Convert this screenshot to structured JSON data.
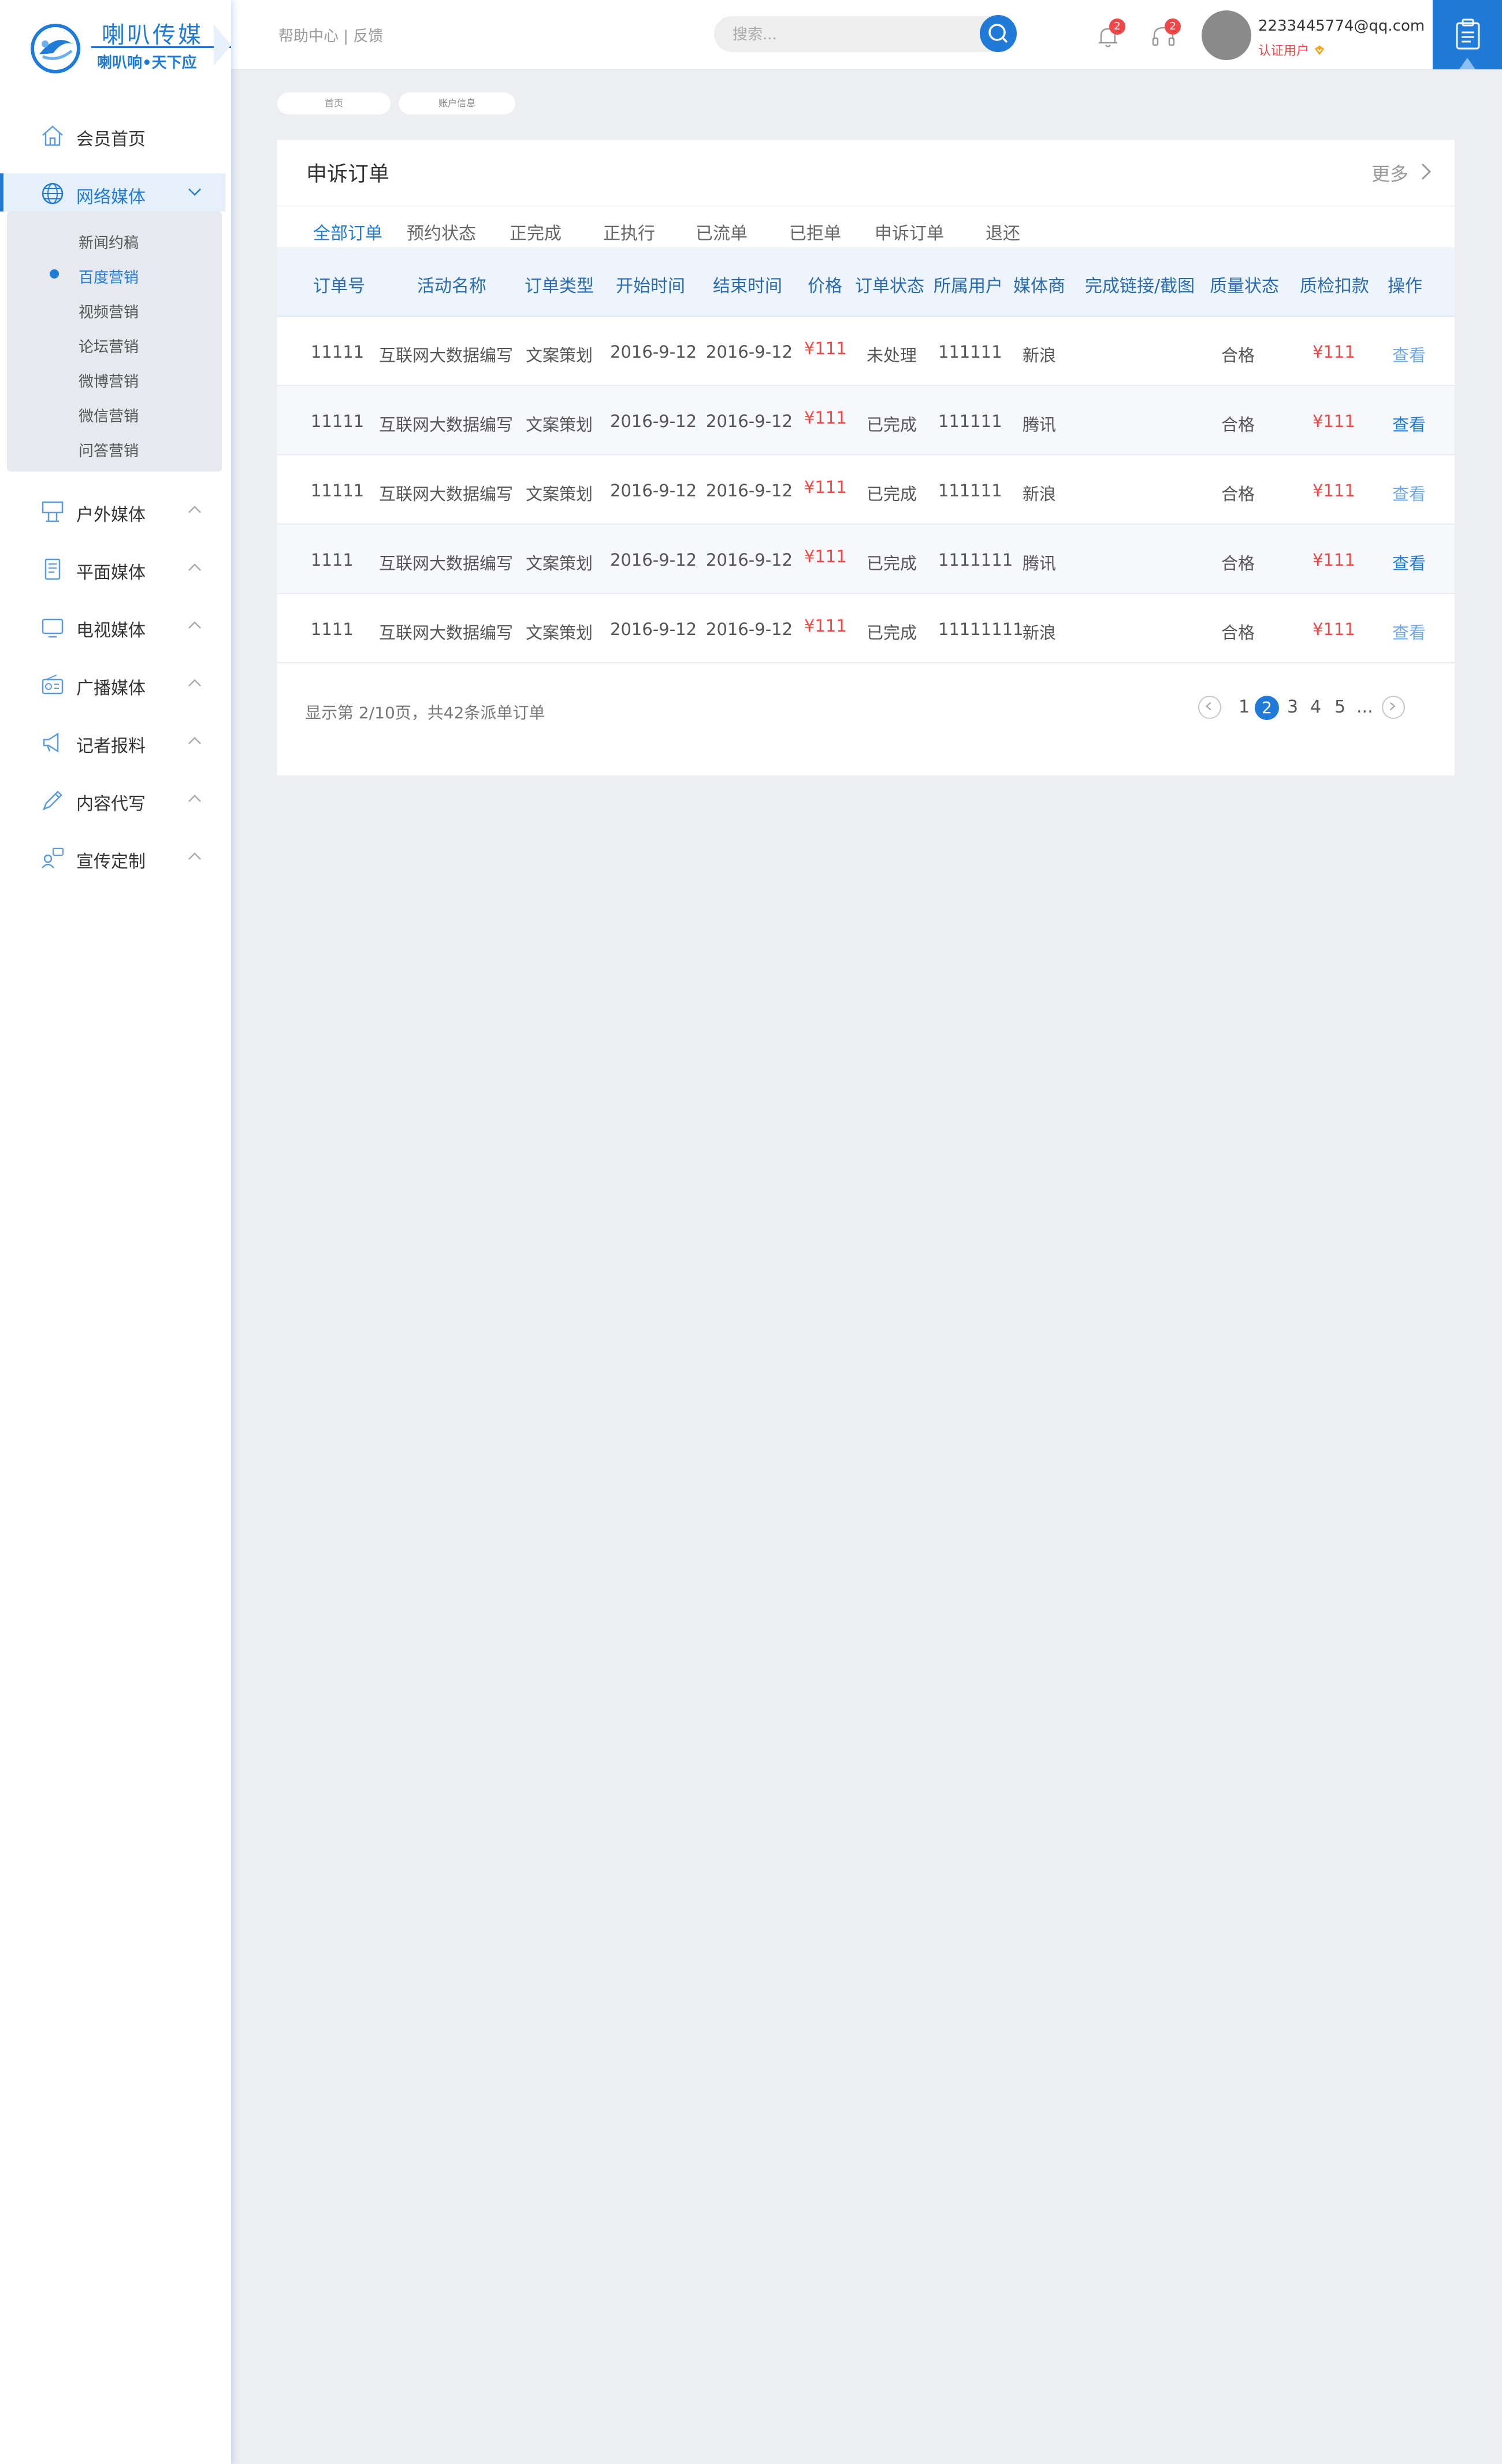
{
  "brand": {
    "title": "喇叭传媒",
    "slogan": "喇叭响•天下应"
  },
  "header": {
    "help": "帮助中心",
    "feedback": "反馈",
    "search_placeholder": "搜索...",
    "notifications_count": "2",
    "service_count": "2",
    "email": "2233445774@qq.com",
    "verified": "认证用户"
  },
  "sidebar": {
    "items": [
      {
        "label": "会员首页",
        "icon": "home-icon"
      },
      {
        "label": "网络媒体",
        "icon": "globe-icon"
      },
      {
        "label": "户外媒体",
        "icon": "billboard-icon"
      },
      {
        "label": "平面媒体",
        "icon": "print-icon"
      },
      {
        "label": "电视媒体",
        "icon": "tv-icon"
      },
      {
        "label": "广播媒体",
        "icon": "radio-icon"
      },
      {
        "label": "记者报料",
        "icon": "megaphone-icon"
      },
      {
        "label": "内容代写",
        "icon": "pen-icon"
      },
      {
        "label": "宣传定制",
        "icon": "custom-icon"
      }
    ],
    "subitems": [
      "新闻约稿",
      "百度营销",
      "视频营销",
      "论坛营销",
      "微博营销",
      "微信营销",
      "问答营销"
    ]
  },
  "breadcrumb": [
    "首页",
    "账户信息"
  ],
  "panel": {
    "title": "申诉订单",
    "more": "更多",
    "tabs": [
      "全部订单",
      "预约状态",
      "正完成",
      "正执行",
      "已流单",
      "已拒单",
      "申诉订单",
      "退还"
    ],
    "columns": [
      "订单号",
      "活动名称",
      "订单类型",
      "开始时间",
      "结束时间",
      "价格",
      "订单状态",
      "所属用户",
      "媒体商",
      "完成链接/截图",
      "质量状态",
      "质检扣款",
      "操作"
    ],
    "rows": [
      {
        "id": "11111",
        "name": "互联网大数据编写",
        "type": "文案策划",
        "start": "2016-9-12",
        "end": "2016-9-12",
        "price": "¥111",
        "status": "未处理",
        "user": "111111",
        "vendor": "新浪",
        "quality": "合格",
        "deduct": "¥111",
        "action": "查看"
      },
      {
        "id": "11111",
        "name": "互联网大数据编写",
        "type": "文案策划",
        "start": "2016-9-12",
        "end": "2016-9-12",
        "price": "¥111",
        "status": "已完成",
        "user": "111111",
        "vendor": "腾讯",
        "quality": "合格",
        "deduct": "¥111",
        "action": "查看"
      },
      {
        "id": "11111",
        "name": "互联网大数据编写",
        "type": "文案策划",
        "start": "2016-9-12",
        "end": "2016-9-12",
        "price": "¥111",
        "status": "已完成",
        "user": "111111",
        "vendor": "新浪",
        "quality": "合格",
        "deduct": "¥111",
        "action": "查看"
      },
      {
        "id": "1111",
        "name": "互联网大数据编写",
        "type": "文案策划",
        "start": "2016-9-12",
        "end": "2016-9-12",
        "price": "¥111",
        "status": "已完成",
        "user": "1111111",
        "vendor": "腾讯",
        "quality": "合格",
        "deduct": "¥111",
        "action": "查看"
      },
      {
        "id": "1111",
        "name": "互联网大数据编写",
        "type": "文案策划",
        "start": "2016-9-12",
        "end": "2016-9-12",
        "price": "¥111",
        "status": "已完成",
        "user": "11111111",
        "vendor": "新浪",
        "quality": "合格",
        "deduct": "¥111",
        "action": "查看"
      }
    ],
    "pagination": {
      "info": "显示第 2/10页，共42条派单订单",
      "pages": [
        "1",
        "2",
        "3",
        "4",
        "5",
        "..."
      ],
      "current": "2"
    }
  },
  "colors": {
    "accent": "#1f7ad8",
    "price": "#f04848"
  }
}
